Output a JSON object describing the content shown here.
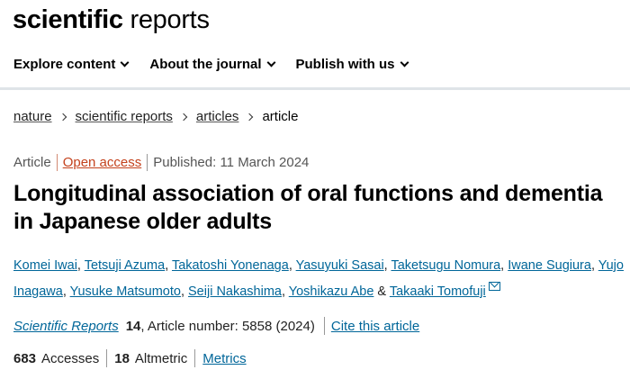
{
  "brand": {
    "bold": "scientific",
    "regular": "reports"
  },
  "nav": [
    {
      "label": "Explore content"
    },
    {
      "label": "About the journal"
    },
    {
      "label": "Publish with us"
    }
  ],
  "breadcrumb": {
    "items": [
      "nature",
      "scientific reports",
      "articles"
    ],
    "current": "article"
  },
  "meta": {
    "type": "Article",
    "access": "Open access",
    "published": "Published: 11 March 2024"
  },
  "article": {
    "title": "Longitudinal association of oral functions and dementia in Japanese older adults"
  },
  "authors": [
    "Komei Iwai",
    "Tetsuji Azuma",
    "Takatoshi Yonenaga",
    "Yasuyuki Sasai",
    "Taketsugu Nomura",
    "Iwane Sugiura",
    "Yujo Inagawa",
    "Yusuke Matsumoto",
    "Seiji Nakashima",
    "Yoshikazu Abe",
    "Takaaki Tomofuji"
  ],
  "author_separators": {
    "comma": ", ",
    "last": " & "
  },
  "journal": {
    "name": "Scientific Reports",
    "volume": "14",
    "article_number": ", Article number: 5858 (2024)",
    "cite_label": "Cite this article"
  },
  "metrics": {
    "accesses_count": "683",
    "accesses_label": "Accesses",
    "altmetric_count": "18",
    "altmetric_label": "Altmetric",
    "metrics_link": "Metrics"
  },
  "colors": {
    "link": "#006699",
    "open_access": "#c4421d",
    "header_border": "#dfe4e8"
  }
}
